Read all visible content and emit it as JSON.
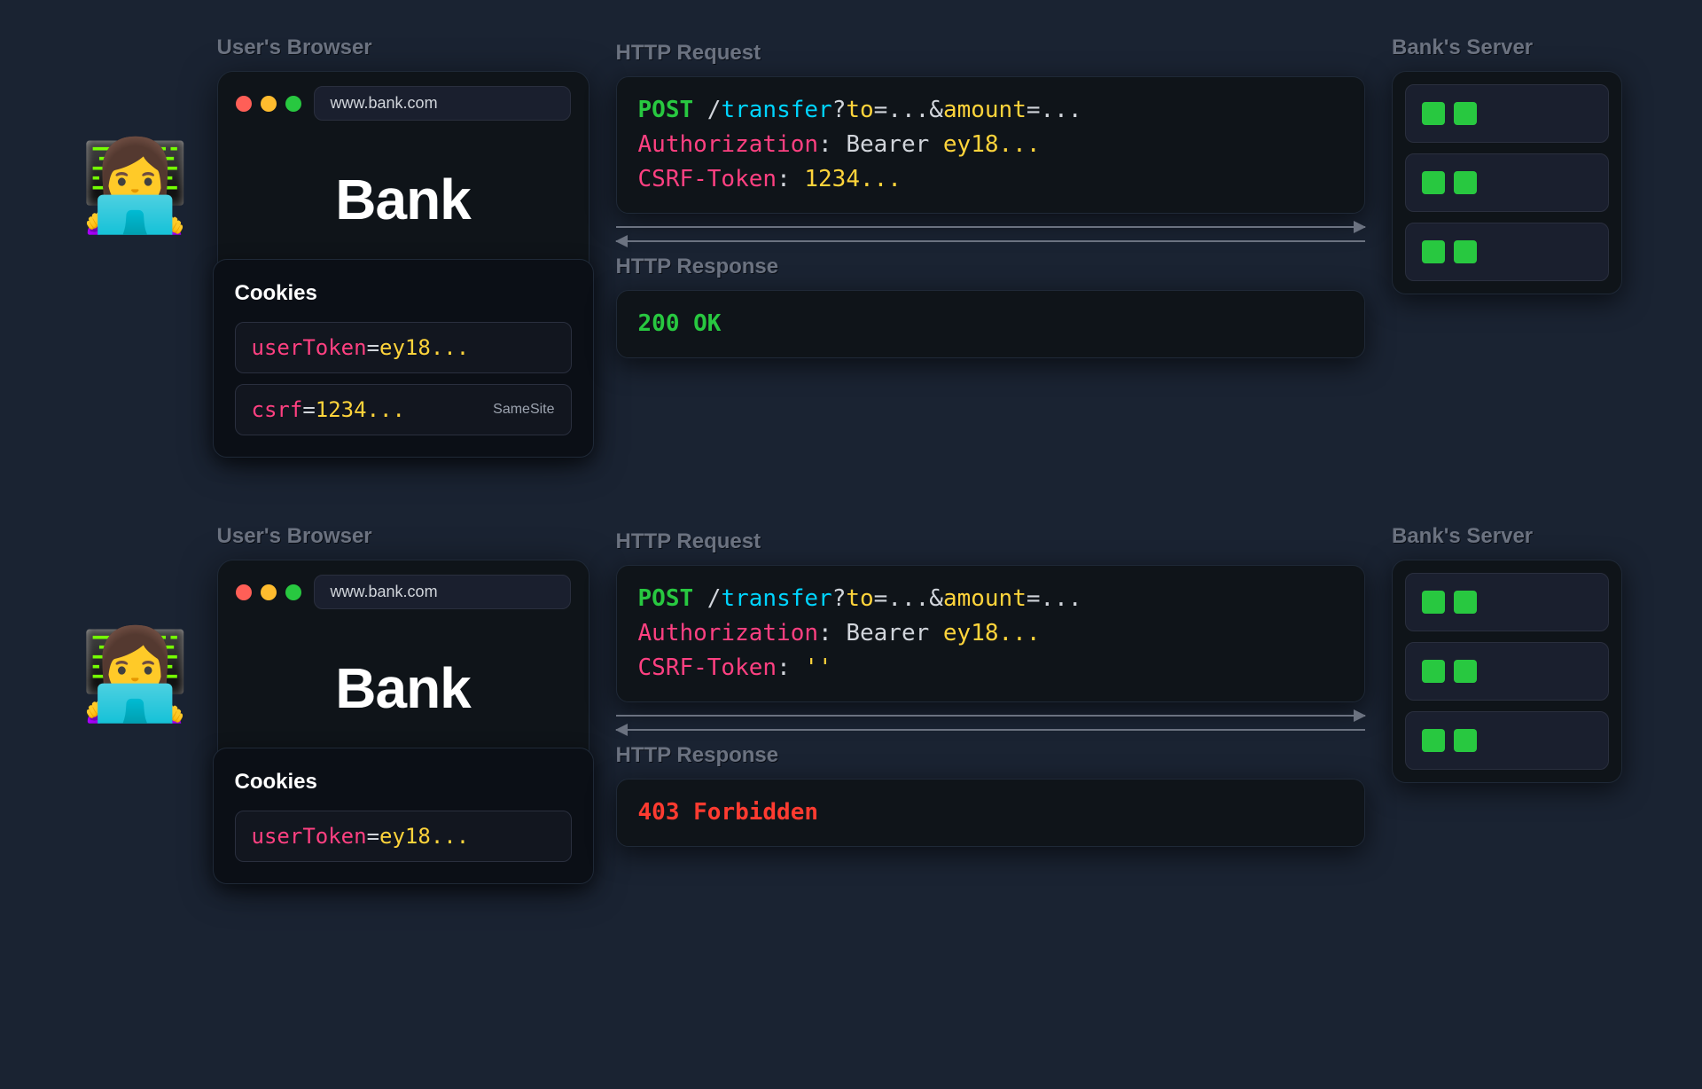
{
  "scenes": [
    {
      "browser_label": "User's Browser",
      "server_label": "Bank's Server",
      "url": "www.bank.com",
      "site_name": "Bank",
      "cookies_title": "Cookies",
      "cookies": [
        {
          "key": "userToken",
          "value": "ey18...",
          "samesite": false
        },
        {
          "key": "csrf",
          "value": "1234...",
          "samesite": true,
          "samesite_label": "SameSite"
        }
      ],
      "request_label": "HTTP Request",
      "request": {
        "method": "POST",
        "path": "/",
        "endpoint": "transfer",
        "params": [
          {
            "key": "to",
            "value": "..."
          },
          {
            "key": "amount",
            "value": "..."
          }
        ],
        "headers": [
          {
            "name": "Authorization",
            "value_prefix": "Bearer ",
            "value": "ey18..."
          },
          {
            "name": "CSRF-Token",
            "value_prefix": "",
            "value": "1234..."
          }
        ]
      },
      "response_label": "HTTP Response",
      "response": {
        "code": "200",
        "text": "OK",
        "ok": true
      }
    },
    {
      "browser_label": "User's Browser",
      "server_label": "Bank's Server",
      "url": "www.bank.com",
      "site_name": "Bank",
      "cookies_title": "Cookies",
      "cookies": [
        {
          "key": "userToken",
          "value": "ey18...",
          "samesite": false
        }
      ],
      "request_label": "HTTP Request",
      "request": {
        "method": "POST",
        "path": "/",
        "endpoint": "transfer",
        "params": [
          {
            "key": "to",
            "value": "..."
          },
          {
            "key": "amount",
            "value": "..."
          }
        ],
        "headers": [
          {
            "name": "Authorization",
            "value_prefix": "Bearer ",
            "value": "ey18..."
          },
          {
            "name": "CSRF-Token",
            "value_prefix": "",
            "value": "''"
          }
        ]
      },
      "response_label": "HTTP Response",
      "response": {
        "code": "403",
        "text": "Forbidden",
        "ok": false
      }
    }
  ]
}
